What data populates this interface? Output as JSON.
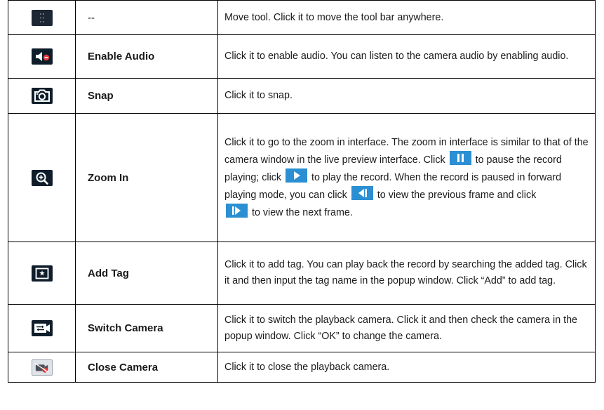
{
  "rows": [
    {
      "icon": "move-handle-icon",
      "name": "--",
      "description": "Move tool. Click it to move the tool bar anywhere."
    },
    {
      "icon": "audio-muted-icon",
      "name": "Enable Audio",
      "description": "Click it to enable audio. You can listen to the camera audio by enabling audio."
    },
    {
      "icon": "camera-snap-icon",
      "name": "Snap",
      "description": "Click it to snap."
    },
    {
      "icon": "zoom-in-icon",
      "name": "Zoom In",
      "description_parts": [
        "Click it to go to the zoom in interface. The zoom in interface is similar to that of the camera window in the live preview interface. Click",
        "to pause the record playing; click",
        "to play the record. When the record is paused in forward playing mode, you can click",
        "to view the previous frame and click",
        "to view the next frame."
      ],
      "inline_icons": [
        "pause-icon",
        "play-icon",
        "previous-frame-icon",
        "next-frame-icon"
      ]
    },
    {
      "icon": "add-tag-icon",
      "name": "Add Tag",
      "description": "Click it to add tag. You can play back the record by searching the added tag. Click it and then input the tag name in the popup window. Click “Add” to add tag."
    },
    {
      "icon": "switch-camera-icon",
      "name": "Switch Camera",
      "description": "Click it to switch the playback camera. Click it and then check the camera in the popup window. Click “OK” to change the camera."
    },
    {
      "icon": "close-camera-icon",
      "name": "Close Camera",
      "description": "Click it to close the playback camera."
    }
  ],
  "colors": {
    "icon_background": "#0f1d2b",
    "inline_button_background": "#2b8fd3",
    "muted_red": "#e23b3b",
    "border": "#000000"
  }
}
